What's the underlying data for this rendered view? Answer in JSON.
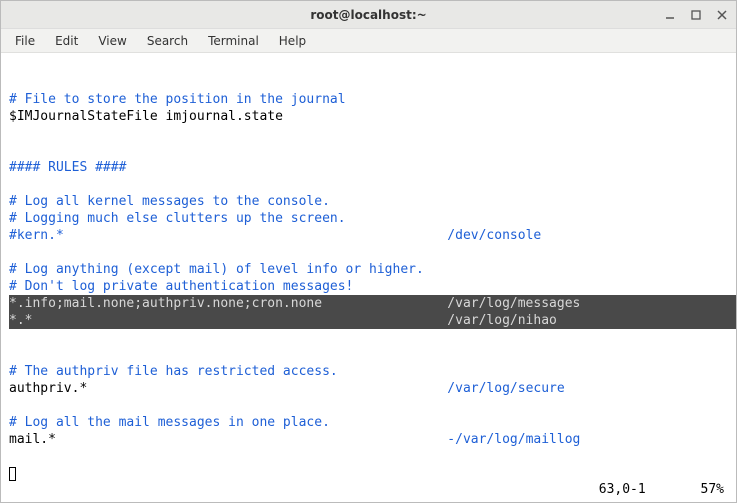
{
  "titlebar": {
    "title": "root@localhost:~"
  },
  "menubar": {
    "file": "File",
    "edit": "Edit",
    "view": "View",
    "search": "Search",
    "terminal": "Terminal",
    "help": "Help"
  },
  "content": {
    "l1": "# File to store the position in the journal",
    "l2": "$IMJournalStateFile imjournal.state",
    "l3": "#### RULES ####",
    "l4": "# Log all kernel messages to the console.",
    "l5": "# Logging much else clutters up the screen.",
    "l6a": "#kern.*                                                 ",
    "l6b": "/dev/console",
    "l7": "# Log anything (except mail) of level info or higher.",
    "l8": "# Don't log private authentication messages!",
    "l9": "*.info;mail.none;authpriv.none;cron.none                /var/log/messages",
    "l10": "*.*                                                     /var/log/nihao",
    "l11": "# The authpriv file has restricted access.",
    "l12a": "authpriv.*                                              ",
    "l12b": "/var/log/secure",
    "l13": "# Log all the mail messages in one place.",
    "l14a": "mail.*                                                  ",
    "l14b": "-/var/log/maillog"
  },
  "status": {
    "position": "63,0-1",
    "percent": "57%"
  }
}
